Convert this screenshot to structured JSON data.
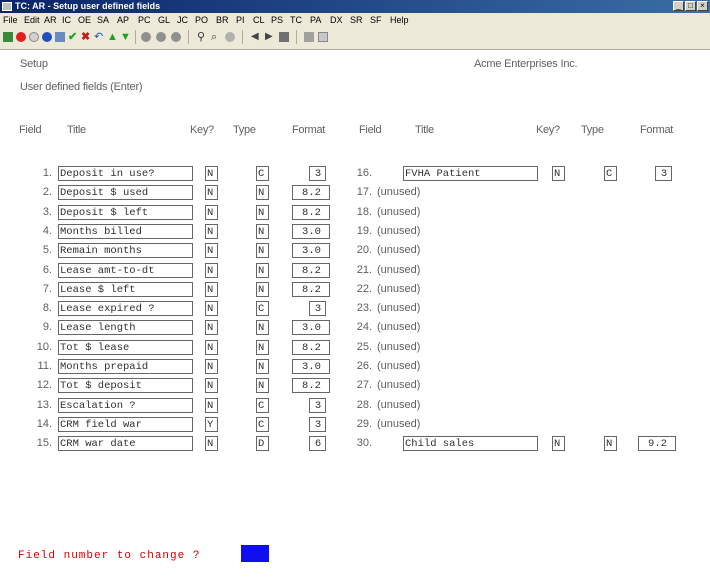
{
  "window": {
    "title": "TC: AR - Setup user defined fields"
  },
  "menu": [
    "File",
    "Edit",
    "AR",
    "IC",
    "OE",
    "SA",
    "AP",
    "PC",
    "GL",
    "JC",
    "PO",
    "BR",
    "PI",
    "CL",
    "PS",
    "TC",
    "PA",
    "DX",
    "SR",
    "SF",
    "Help"
  ],
  "screen": {
    "section": "Setup",
    "subtitle": "User defined fields (Enter)",
    "company": "Acme Enterprises Inc.",
    "headers": {
      "field": "Field",
      "title": "Title",
      "key": "Key?",
      "type": "Type",
      "format": "Format"
    },
    "left_fields": [
      {
        "num": "1.",
        "title": "Deposit in use?",
        "key": "N",
        "type": "C",
        "format": "3"
      },
      {
        "num": "2.",
        "title": "Deposit $ used",
        "key": "N",
        "type": "N",
        "format": "8.2"
      },
      {
        "num": "3.",
        "title": "Deposit $ left",
        "key": "N",
        "type": "N",
        "format": "8.2"
      },
      {
        "num": "4.",
        "title": "Months billed",
        "key": "N",
        "type": "N",
        "format": "3.0"
      },
      {
        "num": "5.",
        "title": "Remain months",
        "key": "N",
        "type": "N",
        "format": "3.0"
      },
      {
        "num": "6.",
        "title": "Lease amt-to-dt",
        "key": "N",
        "type": "N",
        "format": "8.2"
      },
      {
        "num": "7.",
        "title": "Lease $ left",
        "key": "N",
        "type": "N",
        "format": "8.2"
      },
      {
        "num": "8.",
        "title": "Lease expired ?",
        "key": "N",
        "type": "C",
        "format": "3"
      },
      {
        "num": "9.",
        "title": "Lease length",
        "key": "N",
        "type": "N",
        "format": "3.0"
      },
      {
        "num": "10.",
        "title": "Tot $ lease",
        "key": "N",
        "type": "N",
        "format": "8.2"
      },
      {
        "num": "11.",
        "title": "Months prepaid",
        "key": "N",
        "type": "N",
        "format": "3.0"
      },
      {
        "num": "12.",
        "title": "Tot $ deposit",
        "key": "N",
        "type": "N",
        "format": "8.2"
      },
      {
        "num": "13.",
        "title": "Escalation ?",
        "key": "N",
        "type": "C",
        "format": "3"
      },
      {
        "num": "14.",
        "title": "CRM field war",
        "key": "Y",
        "type": "C",
        "format": "3"
      },
      {
        "num": "15.",
        "title": "CRM war date",
        "key": "N",
        "type": "D",
        "format": "6"
      }
    ],
    "right_fields": [
      {
        "num": "16.",
        "title": "FVHA Patient",
        "key": "N",
        "type": "C",
        "format": "3"
      },
      {
        "num": "17.",
        "unused": "(unused)"
      },
      {
        "num": "18.",
        "unused": "(unused)"
      },
      {
        "num": "19.",
        "unused": "(unused)"
      },
      {
        "num": "20.",
        "unused": "(unused)"
      },
      {
        "num": "21.",
        "unused": "(unused)"
      },
      {
        "num": "22.",
        "unused": "(unused)"
      },
      {
        "num": "23.",
        "unused": "(unused)"
      },
      {
        "num": "24.",
        "unused": "(unused)"
      },
      {
        "num": "25.",
        "unused": "(unused)"
      },
      {
        "num": "26.",
        "unused": "(unused)"
      },
      {
        "num": "27.",
        "unused": "(unused)"
      },
      {
        "num": "28.",
        "unused": "(unused)"
      },
      {
        "num": "29.",
        "unused": "(unused)"
      },
      {
        "num": "30.",
        "title": "Child sales",
        "key": "N",
        "type": "N",
        "format": "9.2"
      }
    ],
    "prompt": "Field number to change ?",
    "colors": {
      "prompt": "#d00000",
      "cursor": "#1010ee",
      "titlebar": "#0a246a"
    }
  }
}
